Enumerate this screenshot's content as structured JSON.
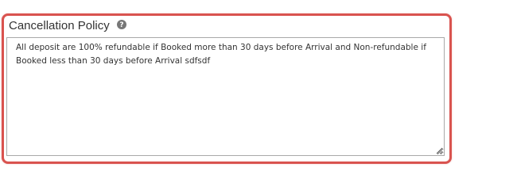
{
  "form": {
    "cancellation_policy": {
      "label": "Cancellation Policy",
      "help_icon": "question-circle-icon",
      "value": "All deposit are 100% refundable if Booked more than 30 days before Arrival and Non-refundable if Booked less than 30 days before Arrival sdfsdf",
      "focus_color": "#d9534f"
    }
  }
}
